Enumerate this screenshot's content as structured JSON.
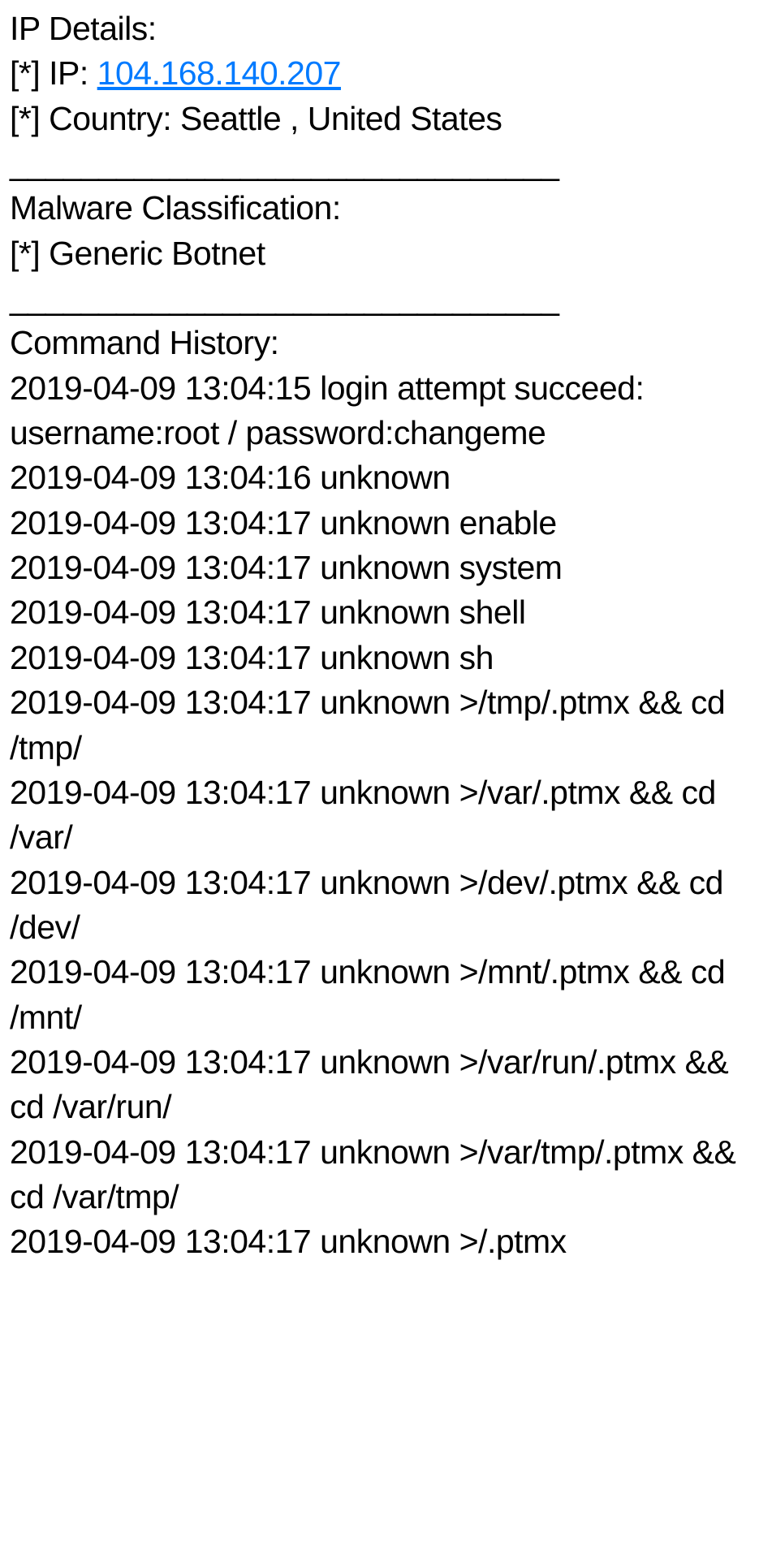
{
  "ip_section": {
    "header": "IP Details:",
    "ip_prefix": " [*] IP:  ",
    "ip_value": "104.168.140.207",
    "country_line": " [*] Country: Seattle , United States"
  },
  "divider": "_______________________________",
  "malware_section": {
    "header": "Malware Classification:",
    "line": " [*] Generic Botnet"
  },
  "history_section": {
    "header": "Command History:",
    "entries": [
      "2019-04-09 13:04:15  login attempt succeed: username:root / password:changeme",
      "2019-04-09 13:04:16 unknown",
      "2019-04-09 13:04:17 unknown enable",
      "2019-04-09 13:04:17 unknown system",
      "2019-04-09 13:04:17 unknown shell",
      "2019-04-09 13:04:17 unknown sh",
      "2019-04-09 13:04:17 unknown >/tmp/.ptmx && cd /tmp/",
      "2019-04-09 13:04:17 unknown >/var/.ptmx && cd /var/",
      "2019-04-09 13:04:17 unknown >/dev/.ptmx && cd /dev/",
      "2019-04-09 13:04:17 unknown >/mnt/.ptmx && cd /mnt/",
      "2019-04-09 13:04:17 unknown >/var/run/.ptmx && cd /var/run/",
      "2019-04-09 13:04:17 unknown >/var/tmp/.ptmx && cd /var/tmp/",
      "2019-04-09 13:04:17 unknown >/.ptmx"
    ]
  }
}
